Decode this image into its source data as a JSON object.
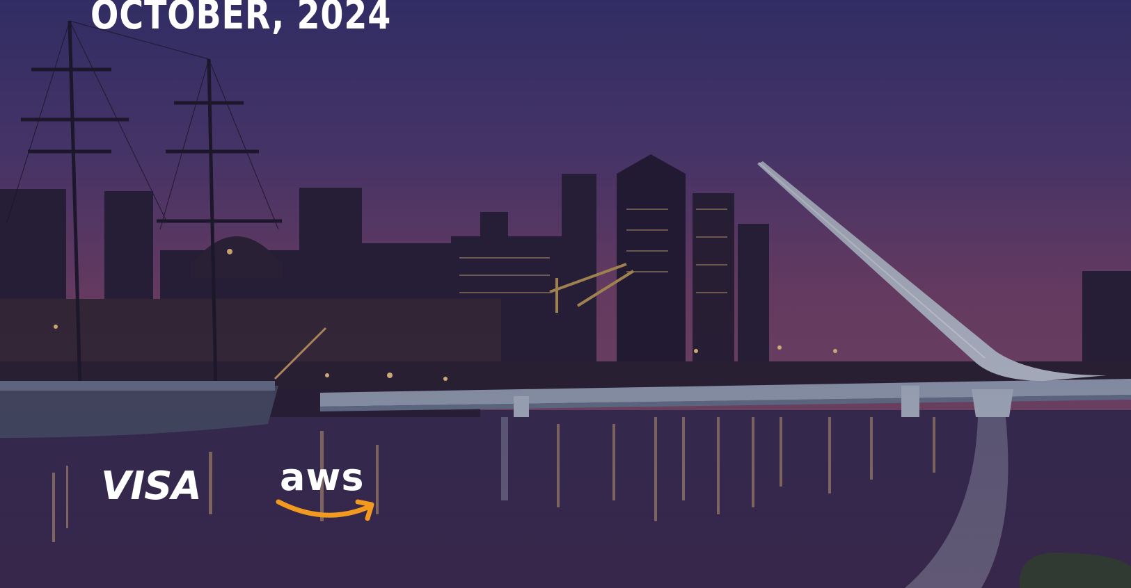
{
  "hero": {
    "date_headline": "OCTOBER, 2024"
  },
  "logos": {
    "visa": "VISA",
    "aws": "aws"
  },
  "colors": {
    "sky_top": "#3f3a7f",
    "sky_mid": "#5a3d78",
    "sky_horizon": "#8a4a6e",
    "water": "#2f2646",
    "bridge": "#c9d2df",
    "aws_smile": "#f29a1f",
    "lights": "#ffd38a"
  }
}
